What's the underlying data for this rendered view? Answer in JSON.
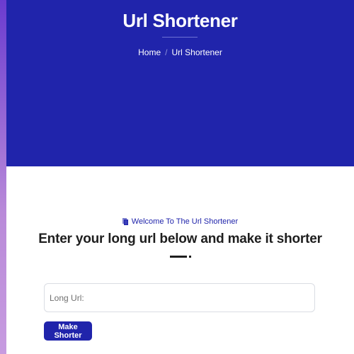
{
  "hero": {
    "title": "Url Shortener",
    "breadcrumb": {
      "home": "Home",
      "separator": "/",
      "current": "Url Shortener"
    }
  },
  "section": {
    "eyebrow_icon": "document-icon",
    "eyebrow": "Welcome To The Url Shortener",
    "headline": "Enter your long url below and make it shorter"
  },
  "form": {
    "url_value": "",
    "url_placeholder": "Long Url:",
    "submit_label": "Make Shorter"
  },
  "colors": {
    "brand": "#2024ab",
    "heading": "#1e1e1e",
    "page_bg": "#ffffff"
  }
}
